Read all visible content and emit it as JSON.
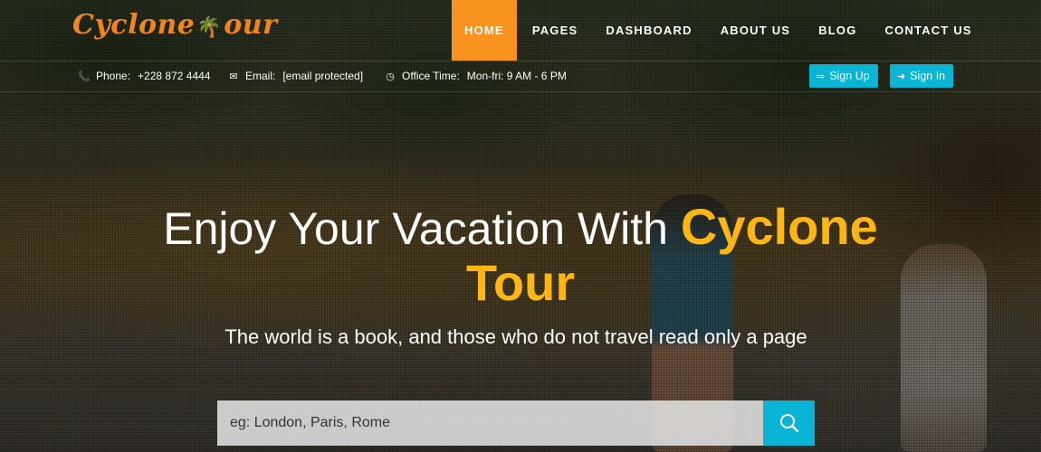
{
  "brand": {
    "logo_text_1": "Cyclone",
    "logo_text_2": "our",
    "logo_icon": "palm-tree-icon",
    "color": "#f0851c"
  },
  "nav": {
    "items": [
      {
        "label": "HOME",
        "active": true
      },
      {
        "label": "PAGES"
      },
      {
        "label": "DASHBOARD"
      },
      {
        "label": "ABOUT US"
      },
      {
        "label": "BLOG"
      },
      {
        "label": "CONTACT US"
      }
    ],
    "active_color": "#f7931e"
  },
  "topbar": {
    "phone_label": "Phone:",
    "phone_value": "+228 872 4444",
    "email_label": "Email:",
    "email_value": "[email protected]",
    "time_label": "Office Time:",
    "time_value": "Mon-fri: 9 AM - 6 PM",
    "signup_label": "Sign Up",
    "signin_label": "Sign In",
    "button_color": "#0ab4d4"
  },
  "hero": {
    "headline_prefix": "Enjoy Your Vacation With",
    "headline_brand_1": "Cyclone",
    "headline_brand_2": "Tour",
    "brand_color": "#ffb612",
    "tagline": "The world is a book, and those who do not travel read only a page"
  },
  "search": {
    "placeholder": "eg: London, Paris, Rome",
    "icon": "search-icon"
  }
}
